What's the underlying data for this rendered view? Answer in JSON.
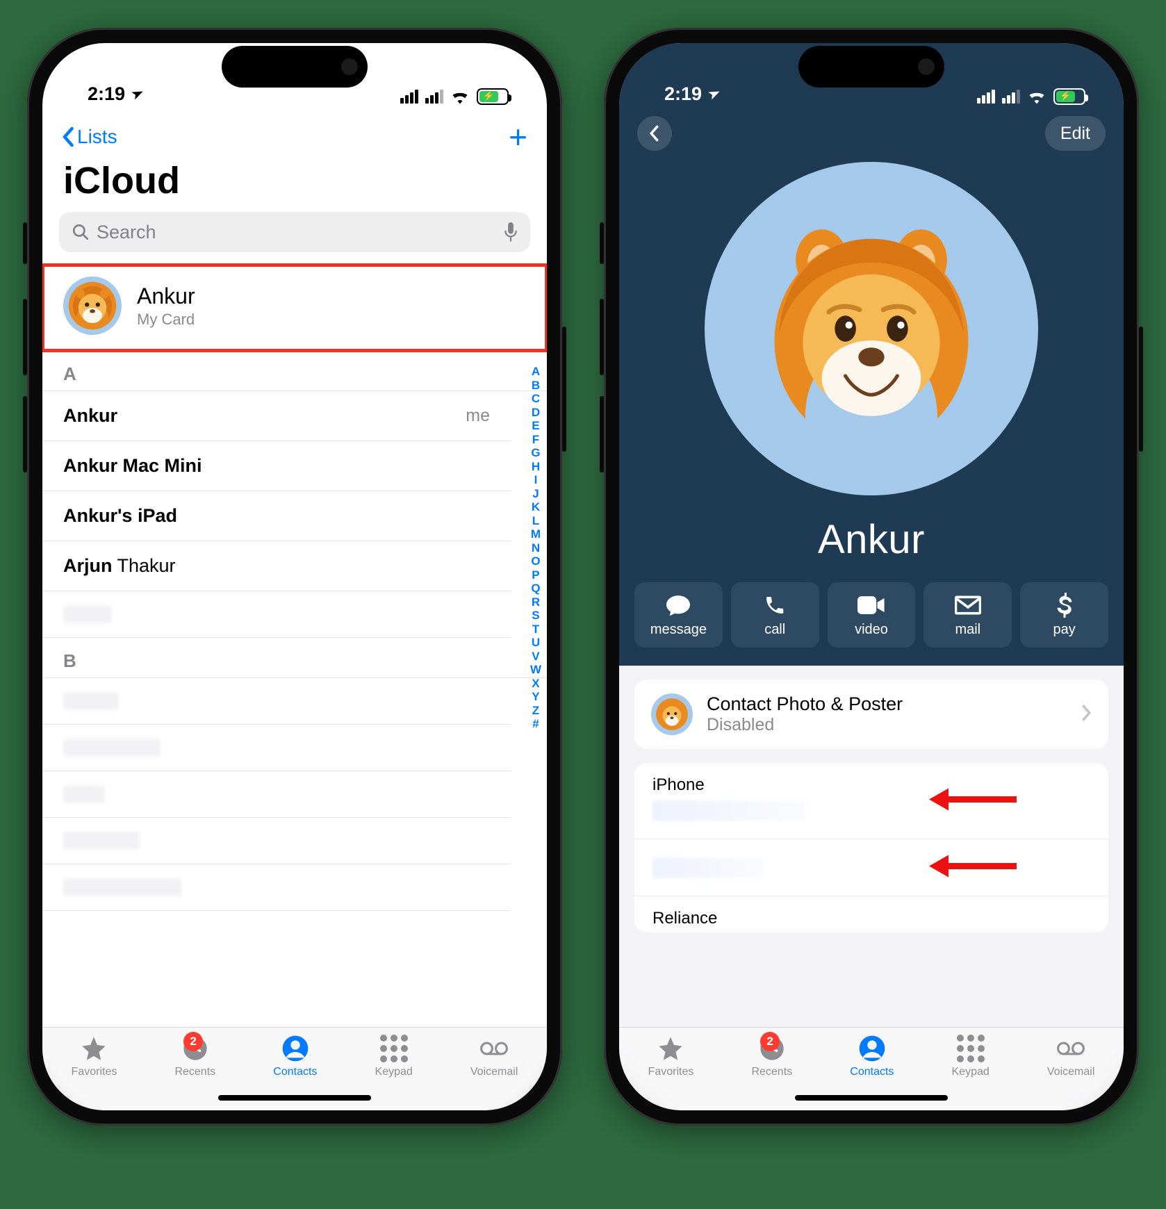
{
  "status": {
    "time": "2:19",
    "battery_state": "charging"
  },
  "index_letters": [
    "A",
    "B",
    "C",
    "D",
    "E",
    "F",
    "G",
    "H",
    "I",
    "J",
    "K",
    "L",
    "M",
    "N",
    "O",
    "P",
    "Q",
    "R",
    "S",
    "T",
    "U",
    "V",
    "W",
    "X",
    "Y",
    "Z",
    "#"
  ],
  "tabs": {
    "favorites": "Favorites",
    "recents": "Recents",
    "recents_badge": "2",
    "contacts": "Contacts",
    "keypad": "Keypad",
    "voicemail": "Voicemail"
  },
  "screen1": {
    "back": "Lists",
    "title": "iCloud",
    "search_placeholder": "Search",
    "my_card": {
      "name": "Ankur",
      "sub": "My Card"
    },
    "sections": {
      "A": [
        {
          "first": "Ankur",
          "last": "",
          "me": "me"
        },
        {
          "first": "Ankur Mac Mini",
          "last": ""
        },
        {
          "first": "Ankur's iPad",
          "last": ""
        },
        {
          "first": "Arjun",
          "last": " Thakur"
        }
      ],
      "B_header": "B"
    },
    "section_a_header": "A"
  },
  "screen2": {
    "edit": "Edit",
    "name": "Ankur",
    "actions": {
      "message": "message",
      "call": "call",
      "video": "video",
      "mail": "mail",
      "pay": "pay"
    },
    "poster": {
      "title": "Contact Photo & Poster",
      "state": "Disabled"
    },
    "phone": {
      "label1": "iPhone",
      "label2": "",
      "label3": "Reliance"
    }
  }
}
